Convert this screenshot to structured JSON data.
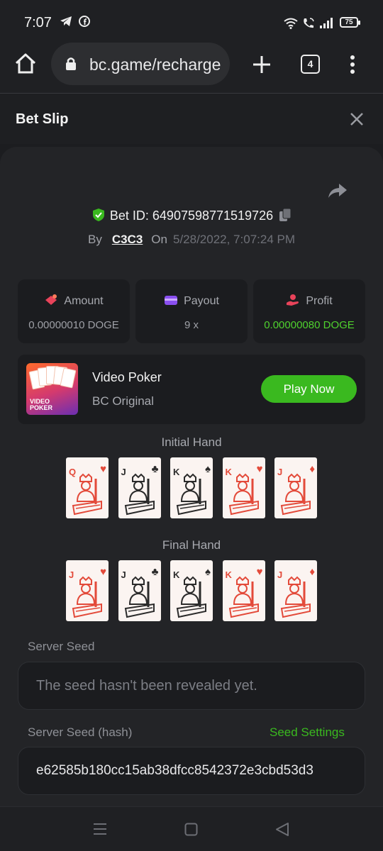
{
  "status_bar": {
    "time": "7:07",
    "battery": "75"
  },
  "browser": {
    "url": "bc.game/recharge",
    "tab_count": "4"
  },
  "header": {
    "title": "Bet Slip"
  },
  "bet": {
    "id_label": "Bet ID: 64907598771519726",
    "by_label": "By",
    "user": "C3C3",
    "on_label": "On",
    "date": "5/28/2022, 7:07:24 PM"
  },
  "stats": [
    {
      "label": "Amount",
      "value": "0.00000010 DOGE"
    },
    {
      "label": "Payout",
      "value": "9 x"
    },
    {
      "label": "Profit",
      "value": "0.00000080 DOGE"
    }
  ],
  "game": {
    "name": "Video Poker",
    "subtitle": "BC Original",
    "play_label": "Play Now",
    "thumb_text_1": "VIDEO",
    "thumb_text_2": "POKER"
  },
  "initial_hand": {
    "title": "Initial Hand",
    "cards": [
      {
        "rank": "Q",
        "suit": "♥",
        "color": "#e34a3a"
      },
      {
        "rank": "J",
        "suit": "♣",
        "color": "#2b2b2b"
      },
      {
        "rank": "K",
        "suit": "♠",
        "color": "#2b2b2b"
      },
      {
        "rank": "K",
        "suit": "♥",
        "color": "#e34a3a"
      },
      {
        "rank": "J",
        "suit": "♦",
        "color": "#e34a3a"
      }
    ]
  },
  "final_hand": {
    "title": "Final Hand",
    "cards": [
      {
        "rank": "J",
        "suit": "♥",
        "color": "#e34a3a"
      },
      {
        "rank": "J",
        "suit": "♣",
        "color": "#2b2b2b"
      },
      {
        "rank": "K",
        "suit": "♠",
        "color": "#2b2b2b"
      },
      {
        "rank": "K",
        "suit": "♥",
        "color": "#e34a3a"
      },
      {
        "rank": "J",
        "suit": "♦",
        "color": "#e34a3a"
      }
    ]
  },
  "server_seed": {
    "label": "Server Seed",
    "placeholder": "The seed hasn't been revealed yet."
  },
  "server_seed_hash": {
    "label": "Server Seed (hash)",
    "settings_label": "Seed Settings",
    "value": "e62585b180cc15ab38dfcc8542372e3cbd53d3"
  },
  "colors": {
    "accent_green": "#3ab91f",
    "profit_green": "#4fd12e",
    "red_suit": "#e34a3a"
  }
}
